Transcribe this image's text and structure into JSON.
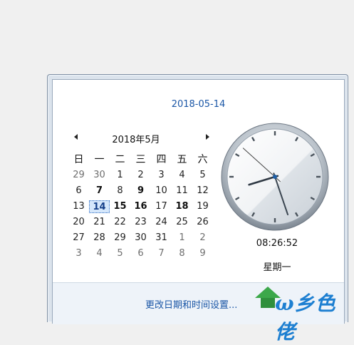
{
  "popup": {
    "date_link": "2018-05-14",
    "month_title": "2018年5月",
    "weekday_headers": [
      "日",
      "一",
      "二",
      "三",
      "四",
      "五",
      "六"
    ],
    "weeks": [
      [
        {
          "d": "29",
          "t": "other"
        },
        {
          "d": "30",
          "t": "other"
        },
        {
          "d": "1",
          "t": ""
        },
        {
          "d": "2",
          "t": ""
        },
        {
          "d": "3",
          "t": ""
        },
        {
          "d": "4",
          "t": ""
        },
        {
          "d": "5",
          "t": ""
        }
      ],
      [
        {
          "d": "6",
          "t": ""
        },
        {
          "d": "7",
          "t": "bold"
        },
        {
          "d": "8",
          "t": ""
        },
        {
          "d": "9",
          "t": "bold"
        },
        {
          "d": "10",
          "t": ""
        },
        {
          "d": "11",
          "t": ""
        },
        {
          "d": "12",
          "t": ""
        }
      ],
      [
        {
          "d": "13",
          "t": ""
        },
        {
          "d": "14",
          "t": "today"
        },
        {
          "d": "15",
          "t": "bold"
        },
        {
          "d": "16",
          "t": "bold"
        },
        {
          "d": "17",
          "t": ""
        },
        {
          "d": "18",
          "t": "bold"
        },
        {
          "d": "19",
          "t": ""
        }
      ],
      [
        {
          "d": "20",
          "t": ""
        },
        {
          "d": "21",
          "t": ""
        },
        {
          "d": "22",
          "t": ""
        },
        {
          "d": "23",
          "t": ""
        },
        {
          "d": "24",
          "t": ""
        },
        {
          "d": "25",
          "t": ""
        },
        {
          "d": "26",
          "t": ""
        }
      ],
      [
        {
          "d": "27",
          "t": ""
        },
        {
          "d": "28",
          "t": ""
        },
        {
          "d": "29",
          "t": ""
        },
        {
          "d": "30",
          "t": ""
        },
        {
          "d": "31",
          "t": ""
        },
        {
          "d": "1",
          "t": "other"
        },
        {
          "d": "2",
          "t": "other"
        }
      ],
      [
        {
          "d": "3",
          "t": "other"
        },
        {
          "d": "4",
          "t": "other"
        },
        {
          "d": "5",
          "t": "other"
        },
        {
          "d": "6",
          "t": "other"
        },
        {
          "d": "7",
          "t": "other"
        },
        {
          "d": "8",
          "t": "other"
        },
        {
          "d": "9",
          "t": "other"
        }
      ]
    ],
    "clock": {
      "digital_time": "08:26:52",
      "hours": 8,
      "minutes": 26,
      "seconds": 52
    },
    "weekday": "星期一",
    "settings_link": "更改日期和时间设置...",
    "prev_icon": "chevron-left-icon",
    "next_icon": "chevron-right-icon",
    "accent_color": "#1a56a6"
  },
  "watermark": {
    "text": "ω乡色佬"
  }
}
